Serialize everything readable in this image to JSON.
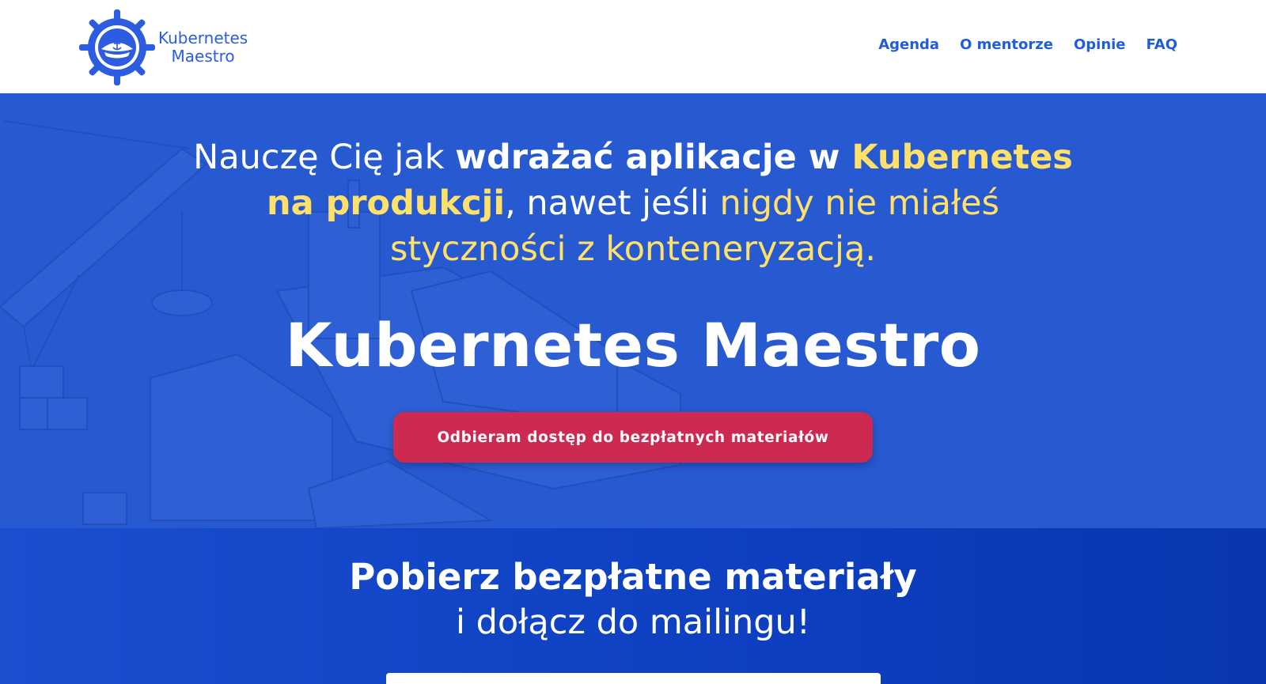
{
  "header": {
    "logo_line1": "Kubernetes",
    "logo_line2": "Maestro",
    "nav": [
      "Agenda",
      "O mentorze",
      "Opinie",
      "FAQ"
    ]
  },
  "hero": {
    "lead_1": "Nauczę Cię jak ",
    "lead_2": "wdrażać aplikacje w ",
    "lead_3": "Kubernetes na produkcji",
    "lead_4": ", nawet jeśli ",
    "lead_5": "nigdy nie miałeś styczności z konteneryzacją.",
    "title": "Kubernetes Maestro",
    "cta": "Odbieram dostęp do bezpłatnych materiałów"
  },
  "signup": {
    "title": "Pobierz bezpłatne materiały",
    "subtitle": "i dołącz do mailingu!"
  },
  "colors": {
    "brand_blue": "#2c5ce0",
    "hero_bg": "#2a5fd8",
    "accent_yellow": "#ffe16a",
    "cta_red": "#cc2a50",
    "signup_bg": "#0d3fc0"
  },
  "icons": [
    "ship-wheel-logo-icon",
    "anchor-icon",
    "captain-hat-icon"
  ]
}
